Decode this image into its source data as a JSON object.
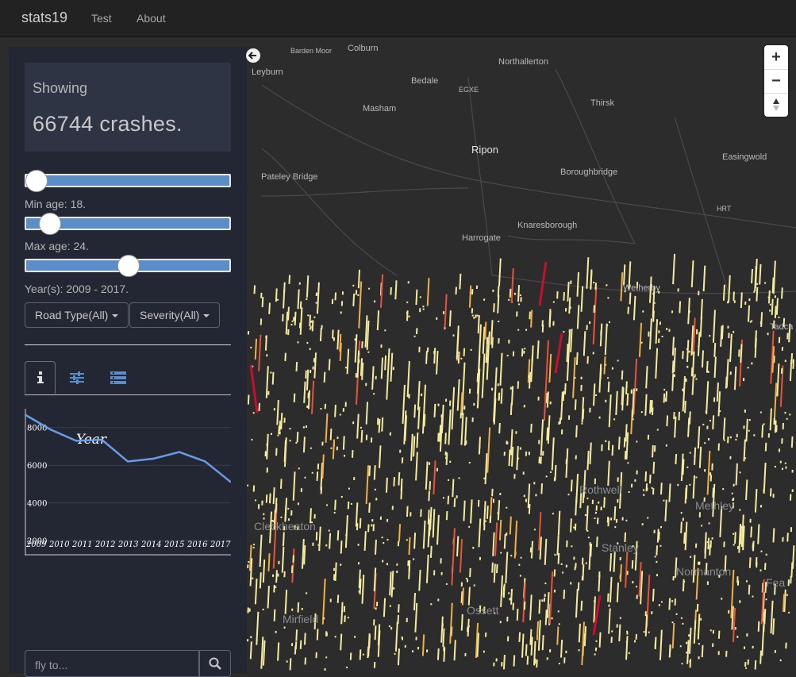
{
  "navbar": {
    "brand": "stats19",
    "links": [
      "Test",
      "About"
    ]
  },
  "sidebar": {
    "showing_label": "Showing",
    "crash_count_text": "66744 crashes.",
    "sliders": [
      {
        "label": "Min age: 18.",
        "value_fraction": 0.05
      },
      {
        "label": "Max age: 24.",
        "value_fraction": 0.12
      },
      {
        "label": "Year(s): 2009 - 2017.",
        "value_fraction": 0.5
      }
    ],
    "dropdowns": {
      "road_type": "Road Type(All)",
      "severity": "Severity(All)"
    },
    "tabs": [
      {
        "name": "info-icon",
        "active": true
      },
      {
        "name": "sliders-icon",
        "active": false
      },
      {
        "name": "layers-icon",
        "active": false
      }
    ],
    "search": {
      "placeholder": "fly to..."
    }
  },
  "chart_data": {
    "type": "line",
    "title": "Year",
    "categories": [
      "2009",
      "2010",
      "2011",
      "2012",
      "2013",
      "2014",
      "2015",
      "2016",
      "2017"
    ],
    "series": [
      {
        "values": [
          8700,
          7900,
          7300,
          7350,
          6200,
          6350,
          6700,
          6200,
          5100
        ]
      }
    ],
    "y_ticks": [
      "8000",
      "6000",
      "4000",
      "2000"
    ],
    "ylim": [
      1500,
      9000
    ],
    "line_color": "#6a9be8"
  },
  "map": {
    "labels": [
      {
        "text": "Barden Moor",
        "cls": "small"
      },
      {
        "text": "Colburn",
        "cls": "normal"
      },
      {
        "text": "Leyburn",
        "cls": "normal"
      },
      {
        "text": "Northallerton",
        "cls": "normal"
      },
      {
        "text": "Bedale",
        "cls": "normal"
      },
      {
        "text": "EGXE",
        "cls": "small"
      },
      {
        "text": "Masham",
        "cls": "normal"
      },
      {
        "text": "Thirsk",
        "cls": "normal"
      },
      {
        "text": "Ripon",
        "cls": "big"
      },
      {
        "text": "Easingwold",
        "cls": "normal"
      },
      {
        "text": "Pateley Bridge",
        "cls": "normal"
      },
      {
        "text": "Boroughbridge",
        "cls": "normal"
      },
      {
        "text": "HRT",
        "cls": "small"
      },
      {
        "text": "Knaresborough",
        "cls": "normal"
      },
      {
        "text": "Harrogate",
        "cls": "normal"
      },
      {
        "text": "Wetherby",
        "cls": "normal"
      },
      {
        "text": "Tadca",
        "cls": "normal"
      },
      {
        "text": "Rothwell",
        "cls": "faint"
      },
      {
        "text": "Methley",
        "cls": "faint"
      },
      {
        "text": "Stanley",
        "cls": "faint"
      },
      {
        "text": "Normanton",
        "cls": "faint"
      },
      {
        "text": "Mirfield",
        "cls": "faint"
      },
      {
        "text": "Ossett",
        "cls": "faint"
      },
      {
        "text": "Fea",
        "cls": "faint"
      },
      {
        "text": "Cleckheaton",
        "cls": "faint"
      }
    ],
    "zoom_in": "+",
    "zoom_out": "−"
  },
  "colors": {
    "bar_light": "#f4eaa0",
    "bar_mid": "#f0b04a",
    "bar_hot": "#e8543a",
    "bar_max": "#c8102e"
  }
}
